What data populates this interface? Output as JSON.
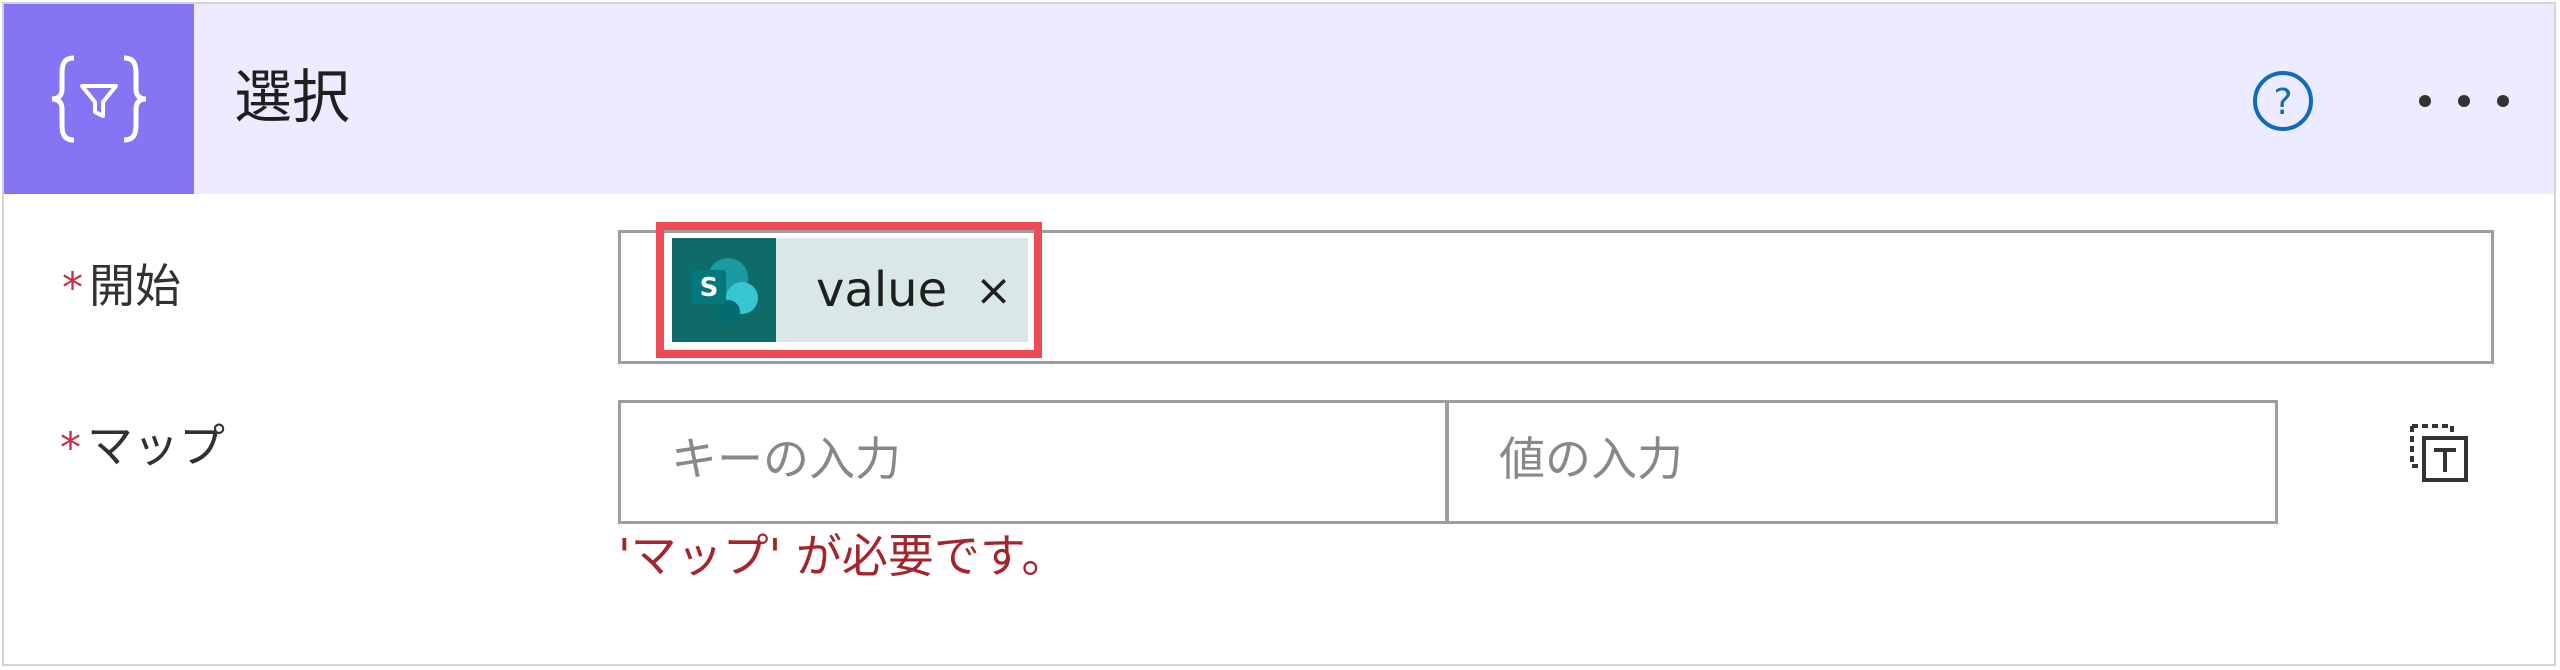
{
  "header": {
    "title": "選択",
    "action_icon": "filter-braces-icon",
    "help_icon": "help-circle-icon",
    "more_icon": "more-icon",
    "accent_color": "#8575f4",
    "background_color": "#ecebff"
  },
  "fields": {
    "from": {
      "required_mark": "*",
      "label": "開始",
      "token": {
        "source_icon": "sharepoint-icon",
        "source_letter": "S",
        "text": "value",
        "remove_label": "×"
      }
    },
    "map": {
      "required_mark": "*",
      "label": "マップ",
      "key_placeholder": "キーの入力",
      "value_placeholder": "値の入力",
      "switch_icon": "text-mode-icon",
      "error": "'マップ' が必要です。"
    }
  }
}
